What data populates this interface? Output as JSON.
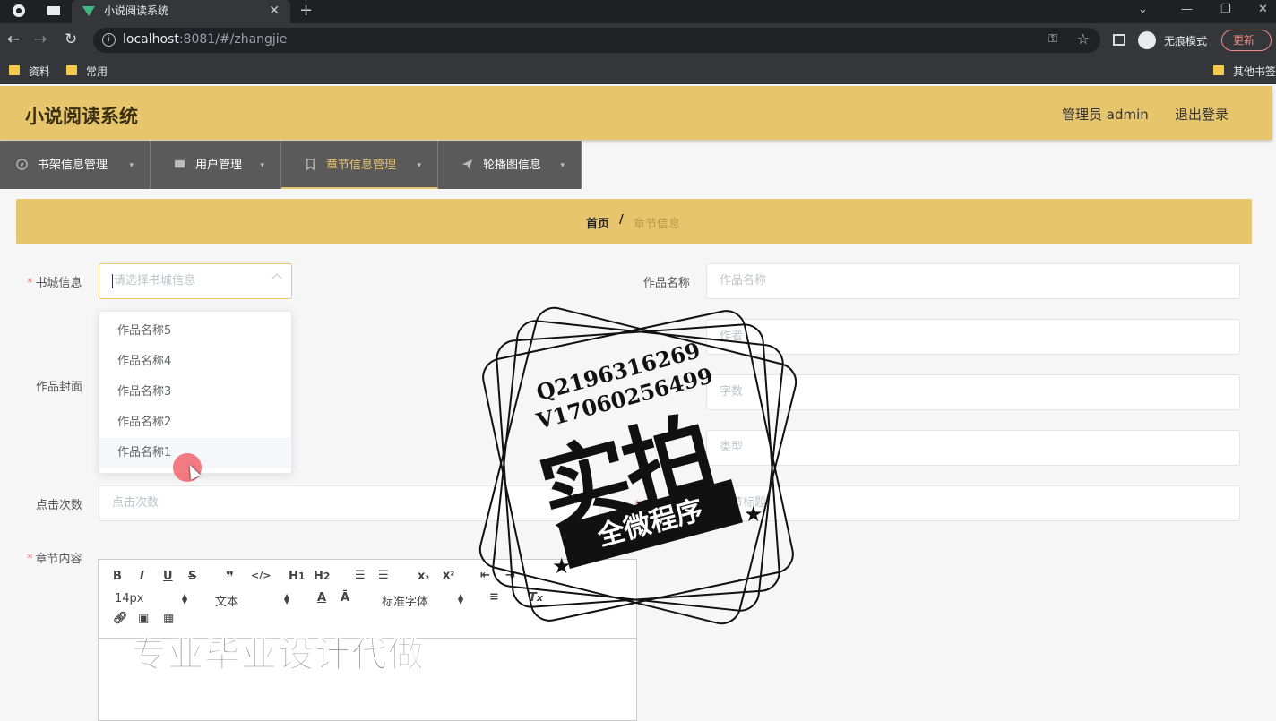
{
  "browser": {
    "tab_title": "小说阅读系统",
    "url_host": "localhost",
    "url_rest": ":8081/#/zhangjie",
    "incognito_label": "无痕模式",
    "update_label": "更新",
    "bookmarks": [
      "资料",
      "常用"
    ],
    "other_bookmarks": "其他书签"
  },
  "app": {
    "title": "小说阅读系统",
    "admin_label": "管理员 admin",
    "logout_label": "退出登录"
  },
  "menu": [
    {
      "label": "书架信息管理",
      "icon": "compass-icon"
    },
    {
      "label": "用户管理",
      "icon": "chat-icon"
    },
    {
      "label": "章节信息管理",
      "icon": "bookmark-icon"
    },
    {
      "label": "轮播图信息",
      "icon": "send-icon"
    }
  ],
  "breadcrumb": {
    "home": "首页",
    "separator": "/",
    "current": "章节信息"
  },
  "form": {
    "shucheng_label": "书城信息",
    "shucheng_placeholder": "请选择书城信息",
    "zuopin_label": "作品名称",
    "zuopin_placeholder": "作品名称",
    "zuozhe_placeholder": "作者",
    "fengmian_label": "作品封面",
    "zishu_placeholder": "字数",
    "leibie_placeholder": "类型",
    "dianji_label": "点击次数",
    "dianji_placeholder": "点击次数",
    "biaoti_label": "章节标题",
    "biaoti_placeholder": "章节标题",
    "neirong_label": "章节内容"
  },
  "dropdown_options": [
    "作品名称5",
    "作品名称4",
    "作品名称3",
    "作品名称2",
    "作品名称1"
  ],
  "editor": {
    "font_size": "14px",
    "header_type": "文本",
    "font_family": "标准字体"
  },
  "watermark": {
    "qq": "Q2196316269",
    "vx": "V17060256499",
    "big": "实拍",
    "band": "全微程序",
    "bottom": "专业毕业设计代做"
  }
}
